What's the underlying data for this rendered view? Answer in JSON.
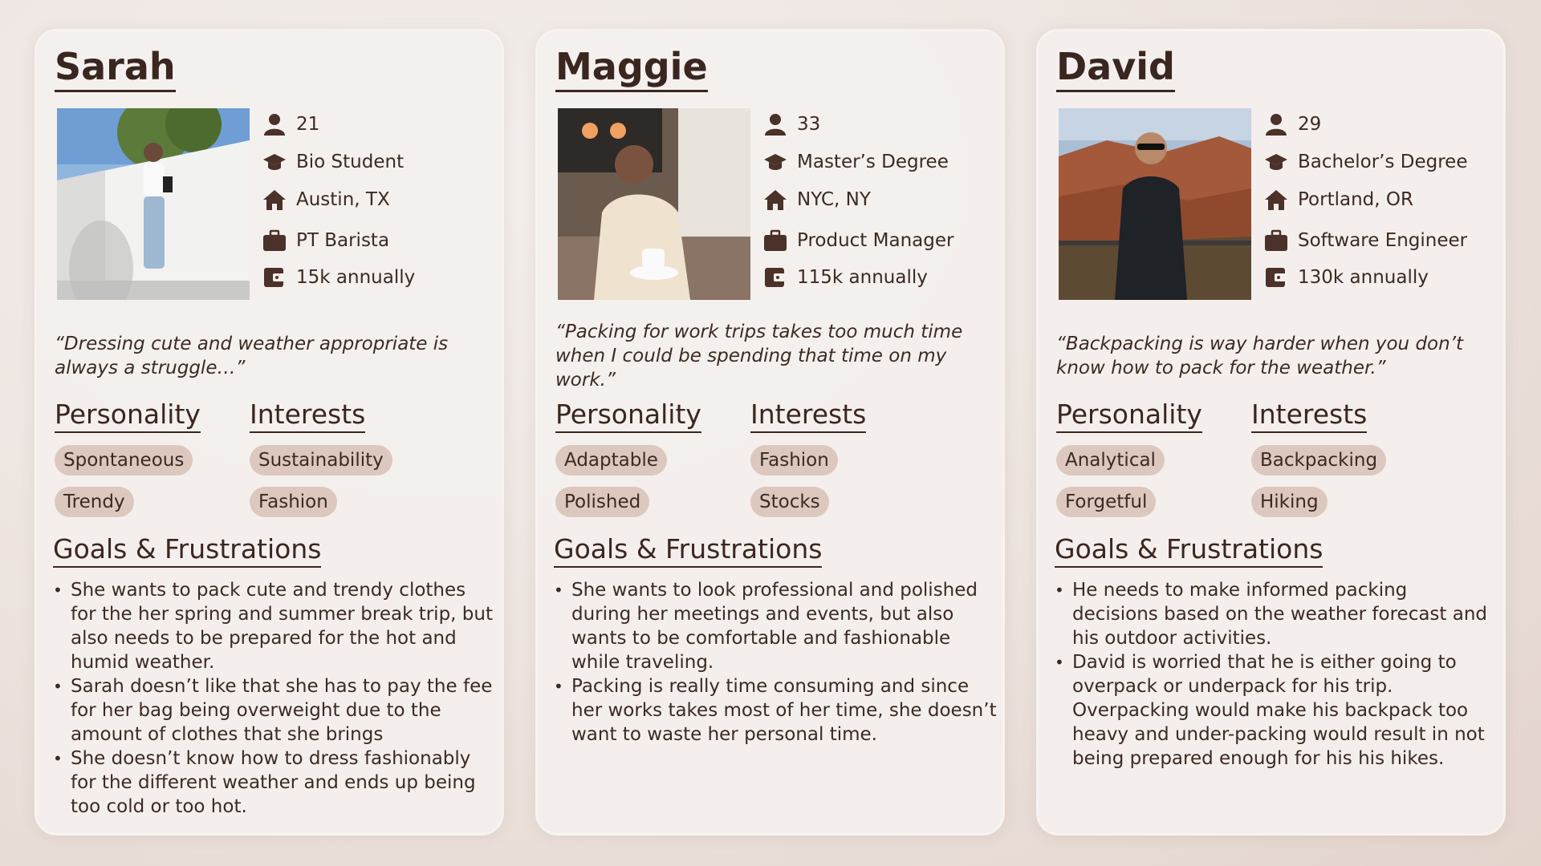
{
  "personas": [
    {
      "name": "Sarah",
      "facts": {
        "age": "21",
        "education": "Bio Student",
        "location": "Austin, TX",
        "job": "PT Barista",
        "income": "15k annually"
      },
      "quote": "“Dressing cute and weather appropriate is always a struggle…”",
      "personality_heading": "Personality",
      "interests_heading": "Interests",
      "personality": [
        "Spontaneous",
        "Trendy"
      ],
      "interests": [
        "Sustainability",
        "Fashion"
      ],
      "goals_heading": "Goals & Frustrations",
      "goals": [
        "She wants to pack cute and trendy clothes for the her spring and summer break trip, but also needs to be prepared for the hot and humid weather.",
        "Sarah doesn’t like that she has to pay the fee for her bag being overweight due to the amount of clothes that she brings",
        "She doesn’t know how to dress fashionably for the different weather and ends up being too cold or too hot."
      ]
    },
    {
      "name": "Maggie",
      "facts": {
        "age": "33",
        "education": "Master’s Degree",
        "location": "NYC, NY",
        "job": "Product Manager",
        "income": "115k annually"
      },
      "quote": "“Packing for work trips takes too much time when I could be spending that time on my work.”",
      "personality_heading": "Personality",
      "interests_heading": "Interests",
      "personality": [
        "Adaptable",
        "Polished"
      ],
      "interests": [
        "Fashion",
        "Stocks"
      ],
      "goals_heading": "Goals & Frustrations",
      "goals": [
        "She wants to look professional and polished during her meetings and events, but also wants to be comfortable and fashionable while traveling.",
        "Packing is really time consuming and since her works takes most of her time, she doesn’t want to waste her personal time."
      ]
    },
    {
      "name": "David",
      "facts": {
        "age": "29",
        "education": "Bachelor’s Degree",
        "location": "Portland, OR",
        "job": "Software Engineer",
        "income": "130k annually"
      },
      "quote": "“Backpacking is way harder when you don’t know how to pack for the weather.”",
      "personality_heading": "Personality",
      "interests_heading": "Interests",
      "personality": [
        "Analytical",
        "Forgetful"
      ],
      "interests": [
        "Backpacking",
        "Hiking"
      ],
      "goals_heading": "Goals & Frustrations",
      "goals": [
        "He needs to make informed packing decisions based on the weather forecast and his outdoor activities.",
        "David is worried that he is either going to overpack or underpack for his trip. Overpacking would make his backpack too heavy and under-packing would result in not being prepared enough for his his hikes."
      ]
    }
  ],
  "icons": [
    "person-icon",
    "graduation-cap-icon",
    "home-icon",
    "briefcase-icon",
    "wallet-icon"
  ],
  "colors": {
    "text": "#3b2a24",
    "tag_bg": "#dcc8be",
    "card_bg": "#f4f0ee"
  }
}
